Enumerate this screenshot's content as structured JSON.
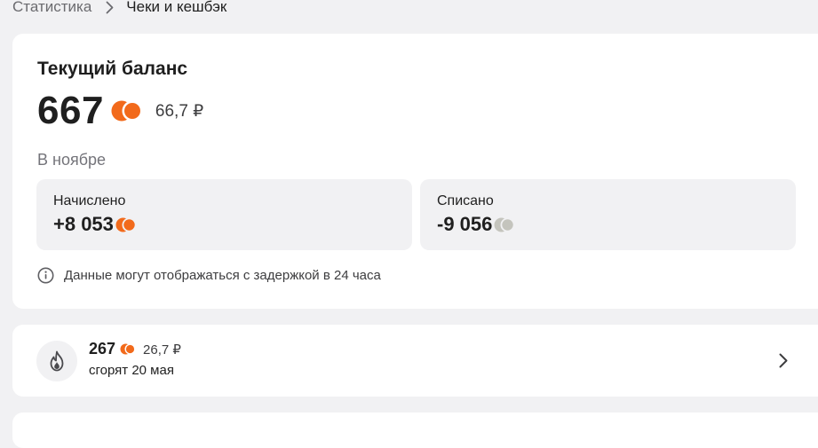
{
  "breadcrumb": {
    "parent": "Статистика",
    "current": "Чеки и кешбэк"
  },
  "balance": {
    "title": "Текущий баланс",
    "value": "667",
    "rub": "66,7 ₽"
  },
  "period": {
    "label": "В ноябре",
    "accrued_label": "Начислено",
    "accrued_value": "+8 053",
    "spent_label": "Списано",
    "spent_value": "-9 056"
  },
  "notice": {
    "text": "Данные могут отображаться с задержкой в 24 часа"
  },
  "burn": {
    "value": "267",
    "rub": "26,7 ₽",
    "date": "сгорят 20 мая"
  },
  "colors": {
    "accent_orange": "#f26a1b",
    "coin_gray": "#c4c4bd",
    "page_bg": "#f1f1f3",
    "card_bg": "#ffffff"
  },
  "icons": {
    "breadcrumb_separator": "chevron-right-icon",
    "coin": "bonus-coin-icon",
    "info": "info-icon",
    "fire": "fire-icon",
    "row_chevron": "chevron-right-icon"
  }
}
